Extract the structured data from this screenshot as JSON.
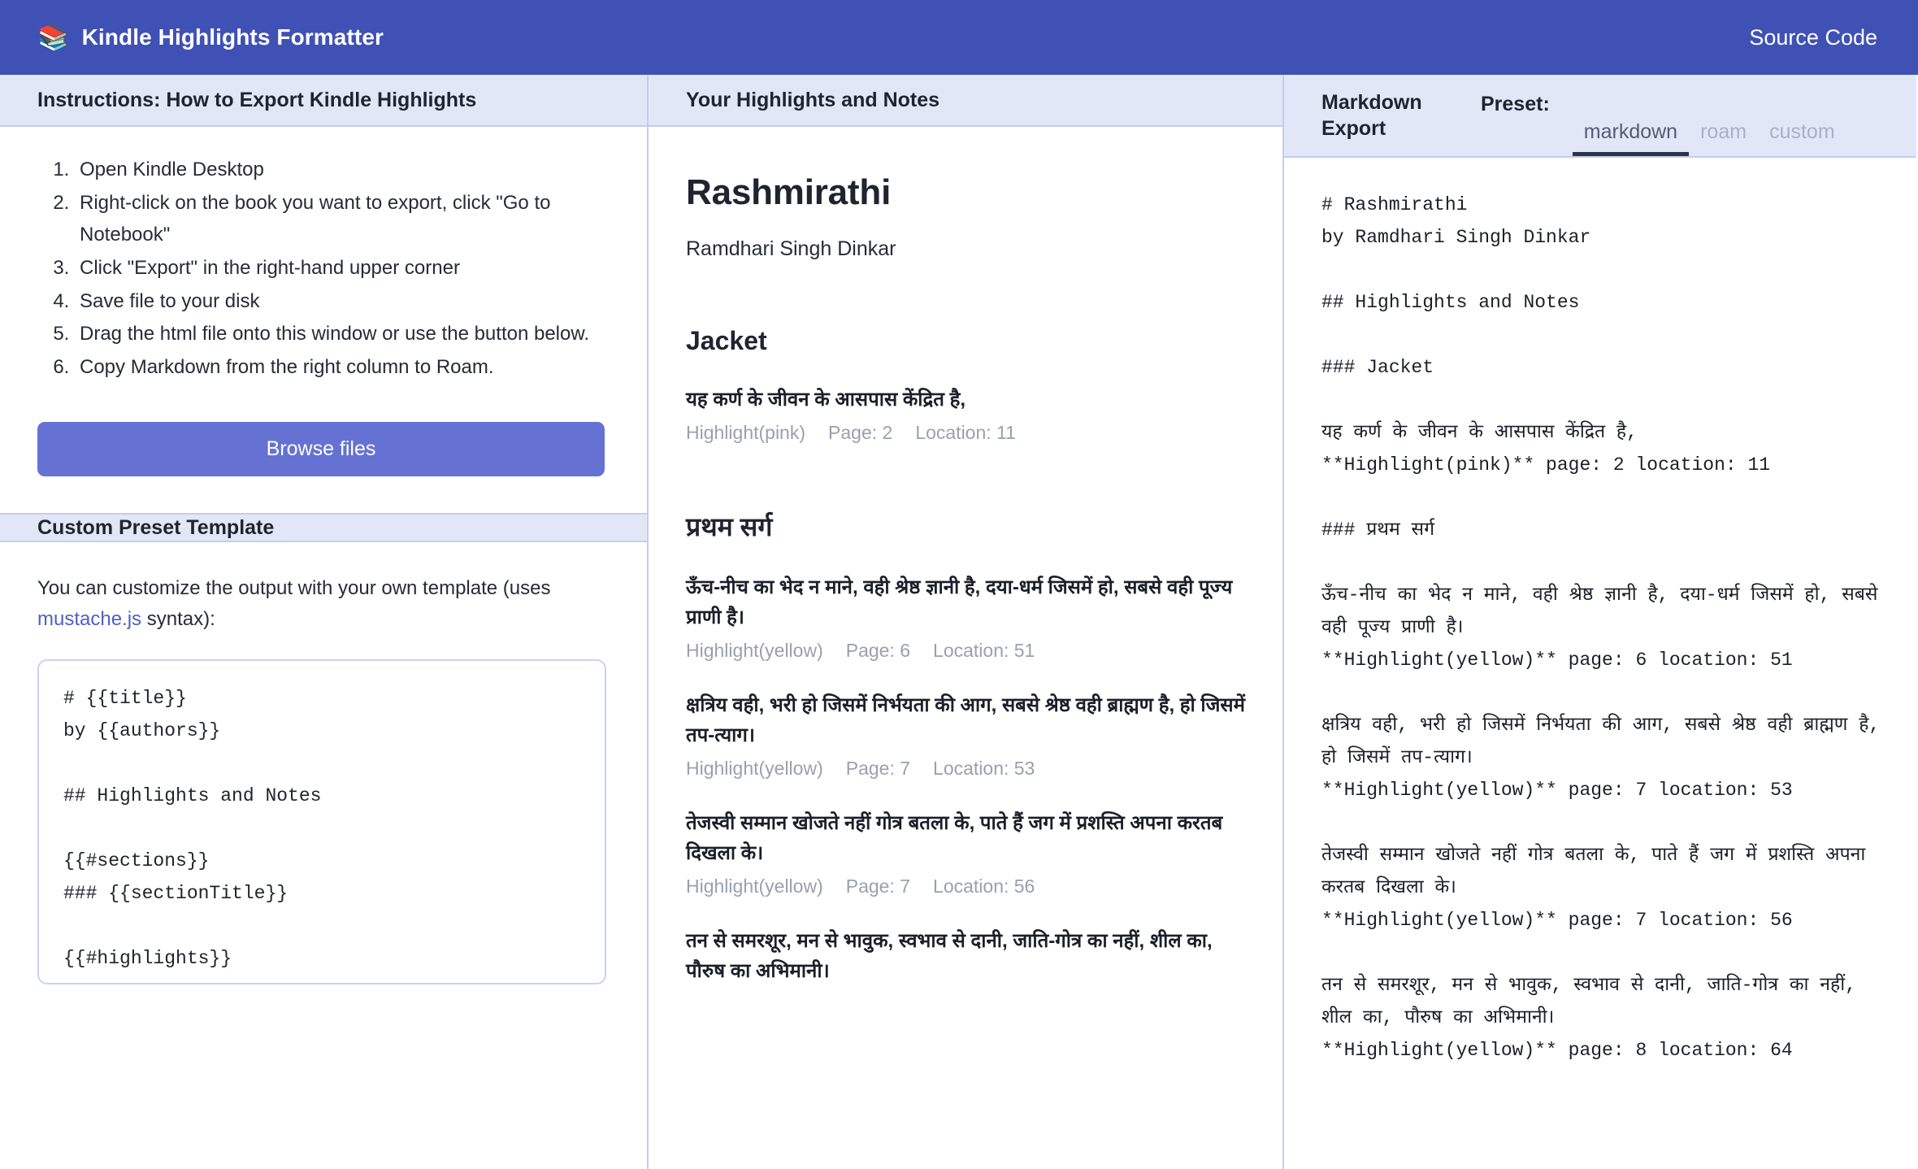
{
  "appbar": {
    "brand_icon": "books-icon",
    "brand_icon_glyph": "📚",
    "title": "Kindle Highlights Formatter",
    "source_code_label": "Source Code",
    "background_color": "#3f51b5"
  },
  "left_panel": {
    "header": "Instructions: How to Export Kindle Highlights",
    "instructions": [
      "Open Kindle Desktop",
      "Right-click on the book you want to export, click \"Go to Notebook\"",
      "Click \"Export\" in the right-hand upper corner",
      "Save file to your disk",
      "Drag the html file onto this window or use the button below.",
      "Copy Markdown from the right column to Roam."
    ],
    "browse_button": "Browse files",
    "custom_header": "Custom Preset Template",
    "custom_intro_before": "You can customize the output with your own template (uses ",
    "custom_intro_link": "mustache.js",
    "custom_intro_after": " syntax):",
    "template_value": "# {{title}}\nby {{authors}}\n\n## Highlights and Notes\n\n{{#sections}}\n### {{sectionTitle}}\n\n{{#highlights}}"
  },
  "middle_panel": {
    "header": "Your Highlights and Notes",
    "book_title": "Rashmirathi",
    "book_author": "Ramdhari Singh Dinkar",
    "sections": [
      {
        "title": "Jacket",
        "highlights": [
          {
            "text": "यह कर्ण के जीवन के आसपास केंद्रित है,",
            "type": "Highlight(pink)",
            "page_label": "Page: 2",
            "location_label": "Location: 11"
          }
        ]
      },
      {
        "title": "प्रथम सर्ग",
        "highlights": [
          {
            "text": "ऊँच-नीच का भेद न माने, वही श्रेष्ठ ज्ञानी है, दया-धर्म जिसमें हो, सबसे वही पूज्य प्राणी है।",
            "type": "Highlight(yellow)",
            "page_label": "Page: 6",
            "location_label": "Location: 51"
          },
          {
            "text": "क्षत्रिय वही, भरी हो जिसमें निर्भयता की आग, सबसे श्रेष्ठ वही ब्राह्मण है, हो जिसमें तप-त्याग।",
            "type": "Highlight(yellow)",
            "page_label": "Page: 7",
            "location_label": "Location: 53"
          },
          {
            "text": "तेजस्वी सम्मान खोजते नहीं गोत्र बतला के, पाते हैं जग में प्रशस्ति अपना करतब दिखला के।",
            "type": "Highlight(yellow)",
            "page_label": "Page: 7",
            "location_label": "Location: 56"
          },
          {
            "text": "तन से समरशूर, मन से भावुक, स्वभाव से दानी, जाति-गोत्र का नहीं, शील का, पौरुष का अभिमानी।",
            "type": "Highlight(yellow)",
            "page_label": "",
            "location_label": ""
          }
        ]
      }
    ]
  },
  "right_panel": {
    "header": "Markdown Export",
    "preset_label": "Preset:",
    "tabs": [
      {
        "label": "markdown",
        "active": true
      },
      {
        "label": "roam",
        "active": false
      },
      {
        "label": "custom",
        "active": false
      }
    ],
    "markdown_output": "# Rashmirathi\nby Ramdhari Singh Dinkar\n\n## Highlights and Notes\n\n### Jacket\n\nयह कर्ण के जीवन के आसपास केंद्रित है,\n**Highlight(pink)** page: 2 location: 11\n\n### प्रथम सर्ग\n\nऊँच-नीच का भेद न माने, वही श्रेष्ठ ज्ञानी है, दया-धर्म जिसमें हो, सबसे वही पूज्य प्राणी है।\n**Highlight(yellow)** page: 6 location: 51\n\nक्षत्रिय वही, भरी हो जिसमें निर्भयता की आग, सबसे श्रेष्ठ वही ब्राह्मण है, हो जिसमें तप-त्याग।\n**Highlight(yellow)** page: 7 location: 53\n\nतेजस्वी सम्मान खोजते नहीं गोत्र बतला के, पाते हैं जग में प्रशस्ति अपना करतब दिखला के।\n**Highlight(yellow)** page: 7 location: 56\n\nतन से समरशूर, मन से भावुक, स्वभाव से दानी, जाति-गोत्र का नहीं, शील का, पौरुष का अभिमानी।\n**Highlight(yellow)** page: 8 location: 64"
  },
  "colors": {
    "accent": "#3f51b5",
    "button": "#6572d4",
    "panel_header_bg": "#e2e7f8",
    "border": "#c5cdee",
    "muted_text": "#9aa0ad",
    "link": "#4f5fc7"
  }
}
